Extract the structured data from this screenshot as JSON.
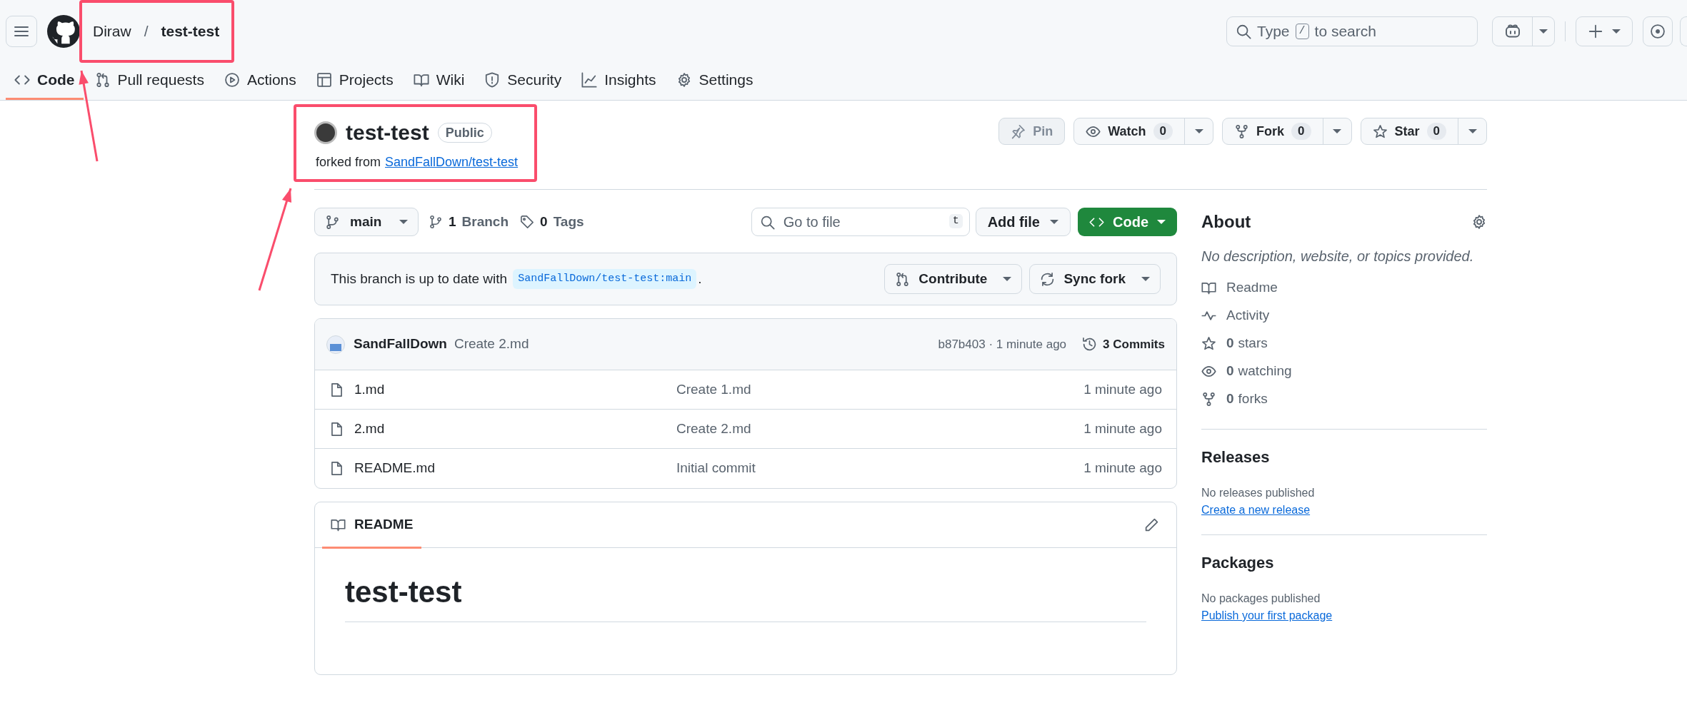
{
  "header": {
    "owner": "Diraw",
    "separator": "/",
    "repo": "test-test",
    "search": {
      "before": "Type",
      "key": "/",
      "after": "to search"
    }
  },
  "nav_tabs": [
    {
      "label": "Code",
      "selected": true
    },
    {
      "label": "Pull requests",
      "selected": false
    },
    {
      "label": "Actions",
      "selected": false
    },
    {
      "label": "Projects",
      "selected": false
    },
    {
      "label": "Wiki",
      "selected": false
    },
    {
      "label": "Security",
      "selected": false
    },
    {
      "label": "Insights",
      "selected": false
    },
    {
      "label": "Settings",
      "selected": false
    }
  ],
  "repo": {
    "name": "test-test",
    "visibility": "Public",
    "forked_label": "forked from",
    "forked_from": "SandFallDown/test-test"
  },
  "repo_actions": [
    {
      "label": "Pin",
      "disabled": true
    },
    {
      "label": "Watch",
      "count": "0",
      "disabled": false
    },
    {
      "label": "Fork",
      "count": "0",
      "disabled": false
    },
    {
      "label": "Star",
      "count": "0",
      "disabled": false
    }
  ],
  "toolbar": {
    "branch": "main",
    "branches_count": "1",
    "branches_label": "Branch",
    "tags_count": "0",
    "tags_label": "Tags",
    "file_search": {
      "placeholder": "Go to file",
      "shortcut": "t"
    },
    "add_file": "Add file",
    "code_button": "Code"
  },
  "sync_banner": {
    "text": "This branch is up to date with",
    "ref": "SandFallDown/test-test:main",
    "end": ".",
    "buttons": [
      "Contribute",
      "Sync fork"
    ]
  },
  "latest_commit": {
    "author": "SandFallDown",
    "message": "Create 2.md",
    "hash_time": "b87b403 · 1 minute ago",
    "commits": "3 Commits"
  },
  "files": [
    {
      "name": "1.md",
      "message": "Create 1.md",
      "time": "1 minute ago"
    },
    {
      "name": "2.md",
      "message": "Create 2.md",
      "time": "1 minute ago"
    },
    {
      "name": "README.md",
      "message": "Initial commit",
      "time": "1 minute ago"
    }
  ],
  "readme": {
    "tab": "README",
    "heading": "test-test"
  },
  "about": {
    "title": "About",
    "description": "No description, website, or topics provided.",
    "items": [
      {
        "label": "Readme"
      },
      {
        "label": "Activity"
      },
      {
        "count": "0",
        "label": "stars"
      },
      {
        "count": "0",
        "label": "watching"
      },
      {
        "count": "0",
        "label": "forks"
      }
    ]
  },
  "releases": {
    "title": "Releases",
    "empty": "No releases published",
    "link": "Create a new release"
  },
  "packages": {
    "title": "Packages",
    "empty": "No packages published",
    "link": "Publish your first package"
  },
  "annotations": [
    {
      "kind": "frame"
    },
    {
      "kind": "frame"
    },
    {
      "kind": "arrow"
    },
    {
      "kind": "arrow"
    }
  ]
}
